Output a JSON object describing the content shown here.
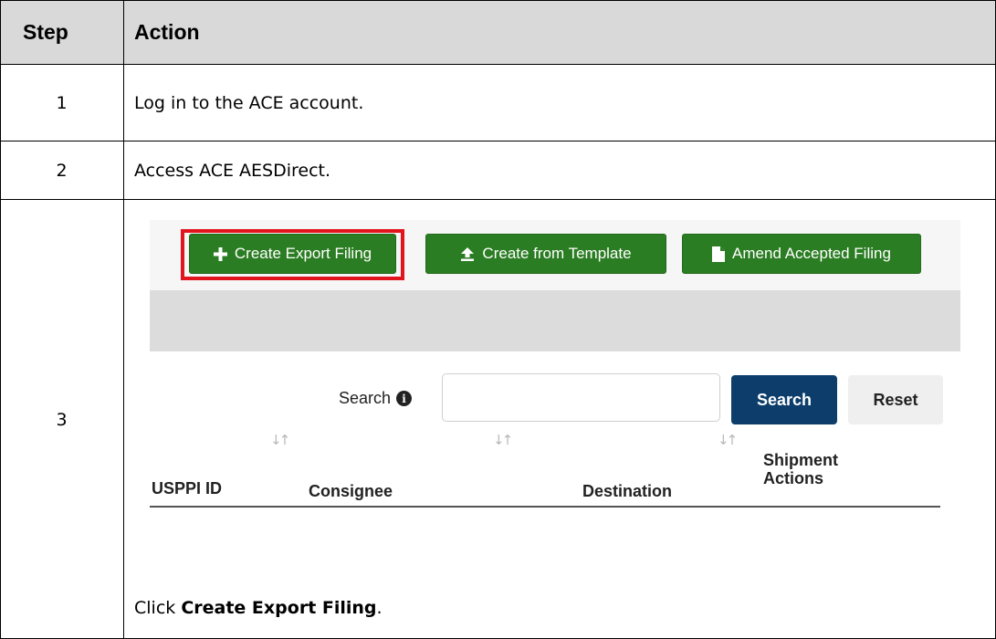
{
  "table": {
    "headers": {
      "step": "Step",
      "action": "Action"
    },
    "rows": [
      {
        "step": "1",
        "action": "Log in to the ACE account."
      },
      {
        "step": "2",
        "action": "Access ACE AESDirect."
      },
      {
        "step": "3"
      }
    ],
    "instruction": {
      "prefix": "Click ",
      "bold": "Create Export Filing",
      "suffix": "."
    }
  },
  "screenshot": {
    "toolbar": {
      "create_export_filing": "Create Export Filing",
      "create_from_template": "Create from Template",
      "amend_accepted_filing": "Amend Accepted Filing"
    },
    "search": {
      "label": "Search",
      "input_value": "",
      "search_button": "Search",
      "reset_button": "Reset"
    },
    "columns": {
      "uspppi_id": "USPPI ID",
      "consignee": "Consignee",
      "destination": "Destination",
      "shipment_actions_line1": "Shipment",
      "shipment_actions_line2": "Actions"
    },
    "colors": {
      "button_green": "#2b7d23",
      "highlight_red": "#e2141d",
      "search_blue": "#0c3d6b"
    },
    "icons": {
      "create_export_filing": "plus-icon",
      "create_from_template": "upload-icon",
      "amend_accepted_filing": "document-icon",
      "search_info": "info-icon",
      "sort": "sort-icon"
    }
  }
}
